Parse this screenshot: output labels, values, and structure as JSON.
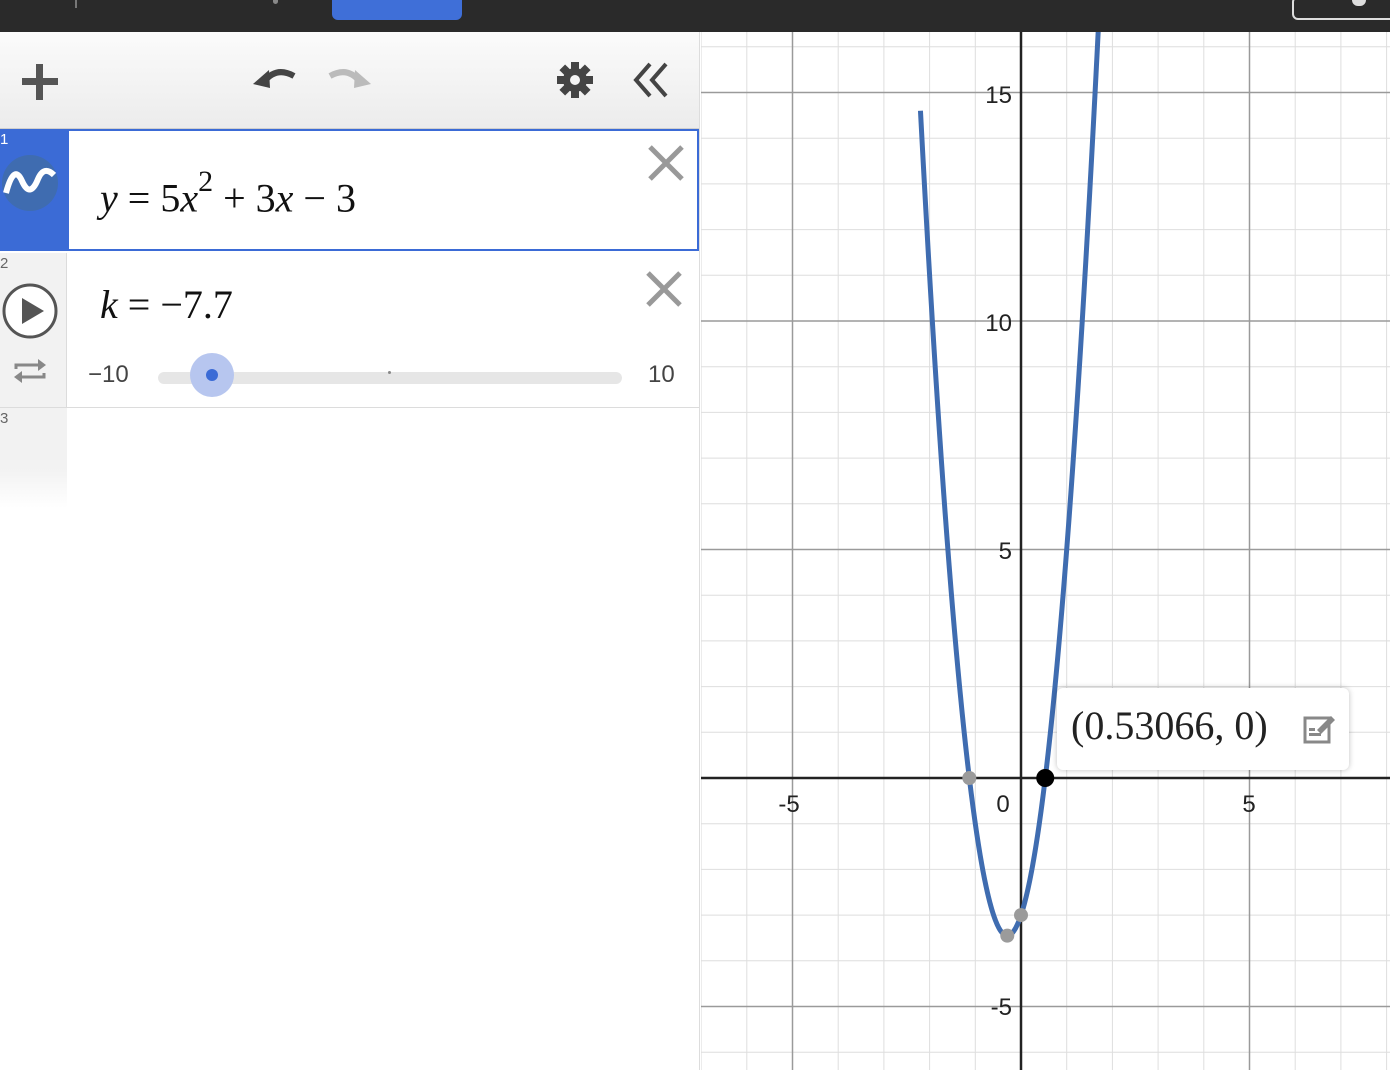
{
  "expressions": [
    {
      "number": "1",
      "latex_parts": {
        "y": "y",
        "eq": " = 5",
        "x1": "x",
        "exp": "2",
        "plus": " + 3",
        "x2": "x",
        "minus": " − 3"
      }
    },
    {
      "number": "2",
      "var": "k",
      "eq": " = −7.7",
      "slider": {
        "min_label": "−10",
        "max_label": "10",
        "value": -7.7,
        "min": -10,
        "max": 10
      }
    },
    {
      "number": "3"
    }
  ],
  "toolbar_icons": [
    "add-icon",
    "undo-icon",
    "redo-icon",
    "settings-icon",
    "collapse-panel-icon"
  ],
  "graph": {
    "x_ticks": [
      "-5",
      "0",
      "5"
    ],
    "y_ticks": [
      "15",
      "10",
      "5",
      "-5"
    ],
    "curve_color": "#3f6cb0",
    "function": {
      "a": 5,
      "b": 3,
      "c": -3
    },
    "points": {
      "selected_root": {
        "x": 0.53066,
        "y": 0,
        "label": "(0.53066, 0)"
      },
      "other_root": {
        "x": -1.13066,
        "y": 0
      },
      "vertex": {
        "x": -0.3,
        "y": -3.45
      },
      "y_intercept": {
        "x": 0,
        "y": -3
      }
    }
  },
  "colors": {
    "accent": "#3b6bd6",
    "topbar": "#2a2a2a"
  }
}
